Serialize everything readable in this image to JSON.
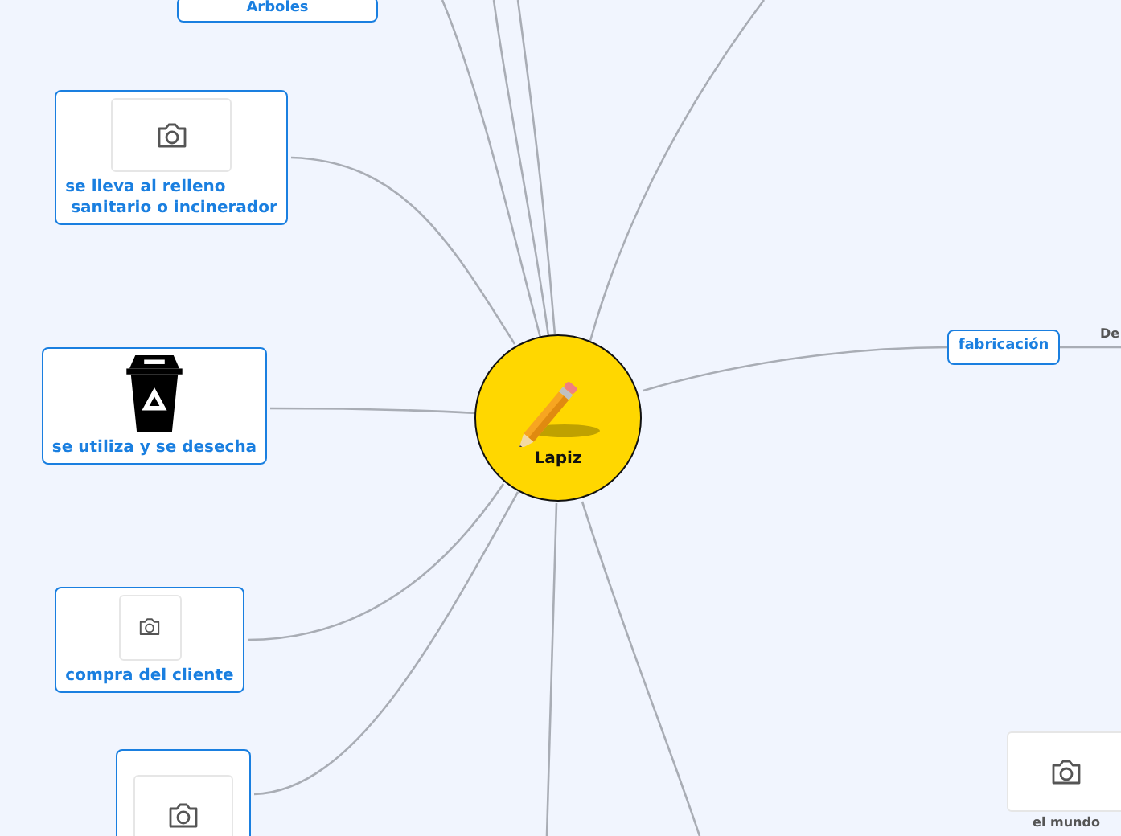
{
  "central_topic": {
    "title": "Lapiz"
  },
  "topics": [
    {
      "label": "Arboles",
      "kind": "text"
    },
    {
      "label": "se lleva al relleno\n sanitario o incinerador",
      "kind": "photo"
    },
    {
      "label": "se utiliza y se desecha",
      "kind": "recycle-bin"
    },
    {
      "label": "compra del cliente",
      "kind": "photo"
    },
    {
      "kind": "photo"
    },
    {
      "label": "fabricación",
      "kind": "text"
    }
  ],
  "subtopics": [
    {
      "label": "De",
      "kind": "text"
    },
    {
      "label": "el mundo",
      "kind": "photo"
    }
  ]
}
